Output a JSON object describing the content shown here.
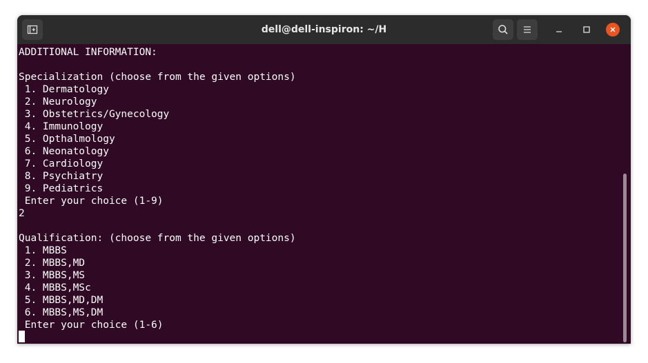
{
  "window": {
    "title": "dell@dell-inspiron: ~/H"
  },
  "terminal": {
    "lines": [
      "ADDITIONAL INFORMATION:",
      "",
      "Specialization (choose from the given options)",
      " 1. Dermatology",
      " 2. Neurology",
      " 3. Obstetrics/Gynecology",
      " 4. Immunology",
      " 5. Opthalmology",
      " 6. Neonatology",
      " 7. Cardiology",
      " 8. Psychiatry",
      " 9. Pediatrics",
      " Enter your choice (1-9)",
      "2",
      "",
      "Qualification: (choose from the given options)",
      " 1. MBBS",
      " 2. MBBS,MD",
      " 3. MBBS,MS",
      " 4. MBBS,MSc",
      " 5. MBBS,MD,DM",
      " 6. MBBS,MS,DM",
      " Enter your choice (1-6)"
    ]
  },
  "colors": {
    "terminal_bg": "#300a24",
    "titlebar_bg": "#2c2c2c",
    "close_button": "#e95420",
    "text": "#ffffff"
  },
  "icons": [
    "new-tab-icon",
    "search-icon",
    "hamburger-menu-icon",
    "minimize-icon",
    "maximize-icon",
    "close-icon"
  ]
}
